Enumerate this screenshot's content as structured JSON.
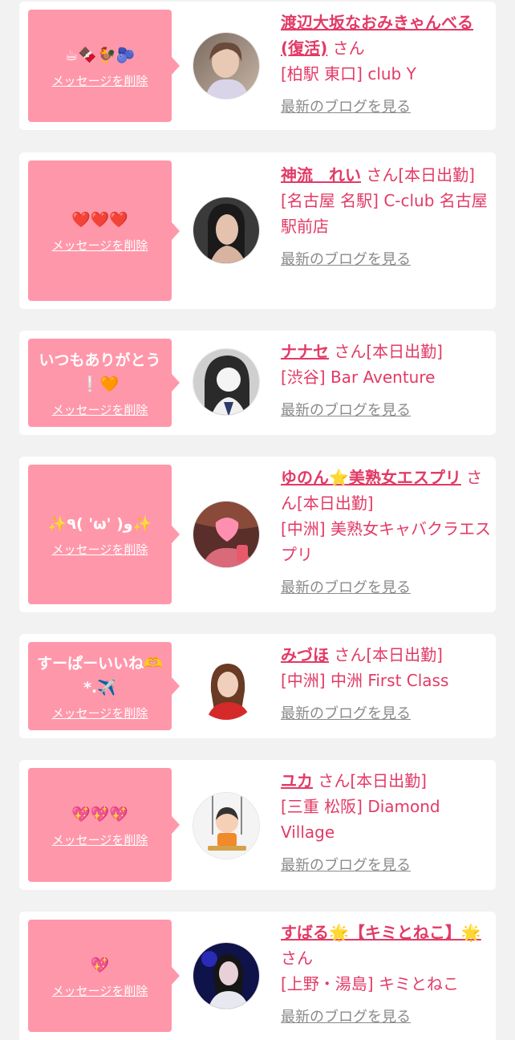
{
  "cards": [
    {
      "message": "☕🍫🐓🫐",
      "delete_label": "メッセージを削除",
      "name": "渡辺大坂なおみきゃんべる(復活)",
      "suffix": "さん",
      "shop": "[柏駅 東口] club Y",
      "blog_label": "最新のブログを見る",
      "avatar": "woman-photo-avatar"
    },
    {
      "message": "❤️❤️❤️",
      "delete_label": "メッセージを削除",
      "name": "神流　れい",
      "suffix": "さん[本日出勤]",
      "shop": "[名古屋 名駅] C-club 名古屋駅前店",
      "blog_label": "最新のブログを見る",
      "avatar": "woman-photo-avatar"
    },
    {
      "message": "いつもありがとう❕🧡",
      "delete_label": "メッセージを削除",
      "name": "ナナセ",
      "suffix": "さん[本日出勤]",
      "shop": "[渋谷] Bar Aventure",
      "blog_label": "最新のブログを見る",
      "avatar": "woman-photo-avatar"
    },
    {
      "message": "✨٩( 'ω' )و✨",
      "delete_label": "メッセージを削除",
      "name": "ゆのん⭐️美熟女エスプリ",
      "suffix": "さん[本日出勤]",
      "shop": "[中洲] 美熟女キャバクラエスプリ",
      "blog_label": "最新のブログを見る",
      "avatar": "woman-photo-avatar"
    },
    {
      "message": "すーぱーいいね🫶*.✈️",
      "delete_label": "メッセージを削除",
      "name": "みづほ",
      "suffix": "さん[本日出勤]",
      "shop": "[中洲] 中洲 First Class",
      "blog_label": "最新のブログを見る",
      "avatar": "woman-photo-avatar"
    },
    {
      "message": "💖💖💖",
      "delete_label": "メッセージを削除",
      "name": "ユカ",
      "suffix": "さん[本日出勤]",
      "shop": "[三重 松阪] Diamond Village",
      "blog_label": "最新のブログを見る",
      "avatar": "swing-illustration-avatar"
    },
    {
      "message": "💖",
      "delete_label": "メッセージを削除",
      "name": "すばる🌟【キミとねこ】🌟",
      "suffix": "さん",
      "shop": "[上野・湯島] キミとねこ",
      "blog_label": "最新のブログを見る",
      "avatar": "woman-photo-avatar"
    }
  ],
  "colors": {
    "page_bg": "#f2f2f2",
    "bubble": "#ff97aa",
    "accent": "#e23a66",
    "link_gray": "#8a8a8a"
  }
}
